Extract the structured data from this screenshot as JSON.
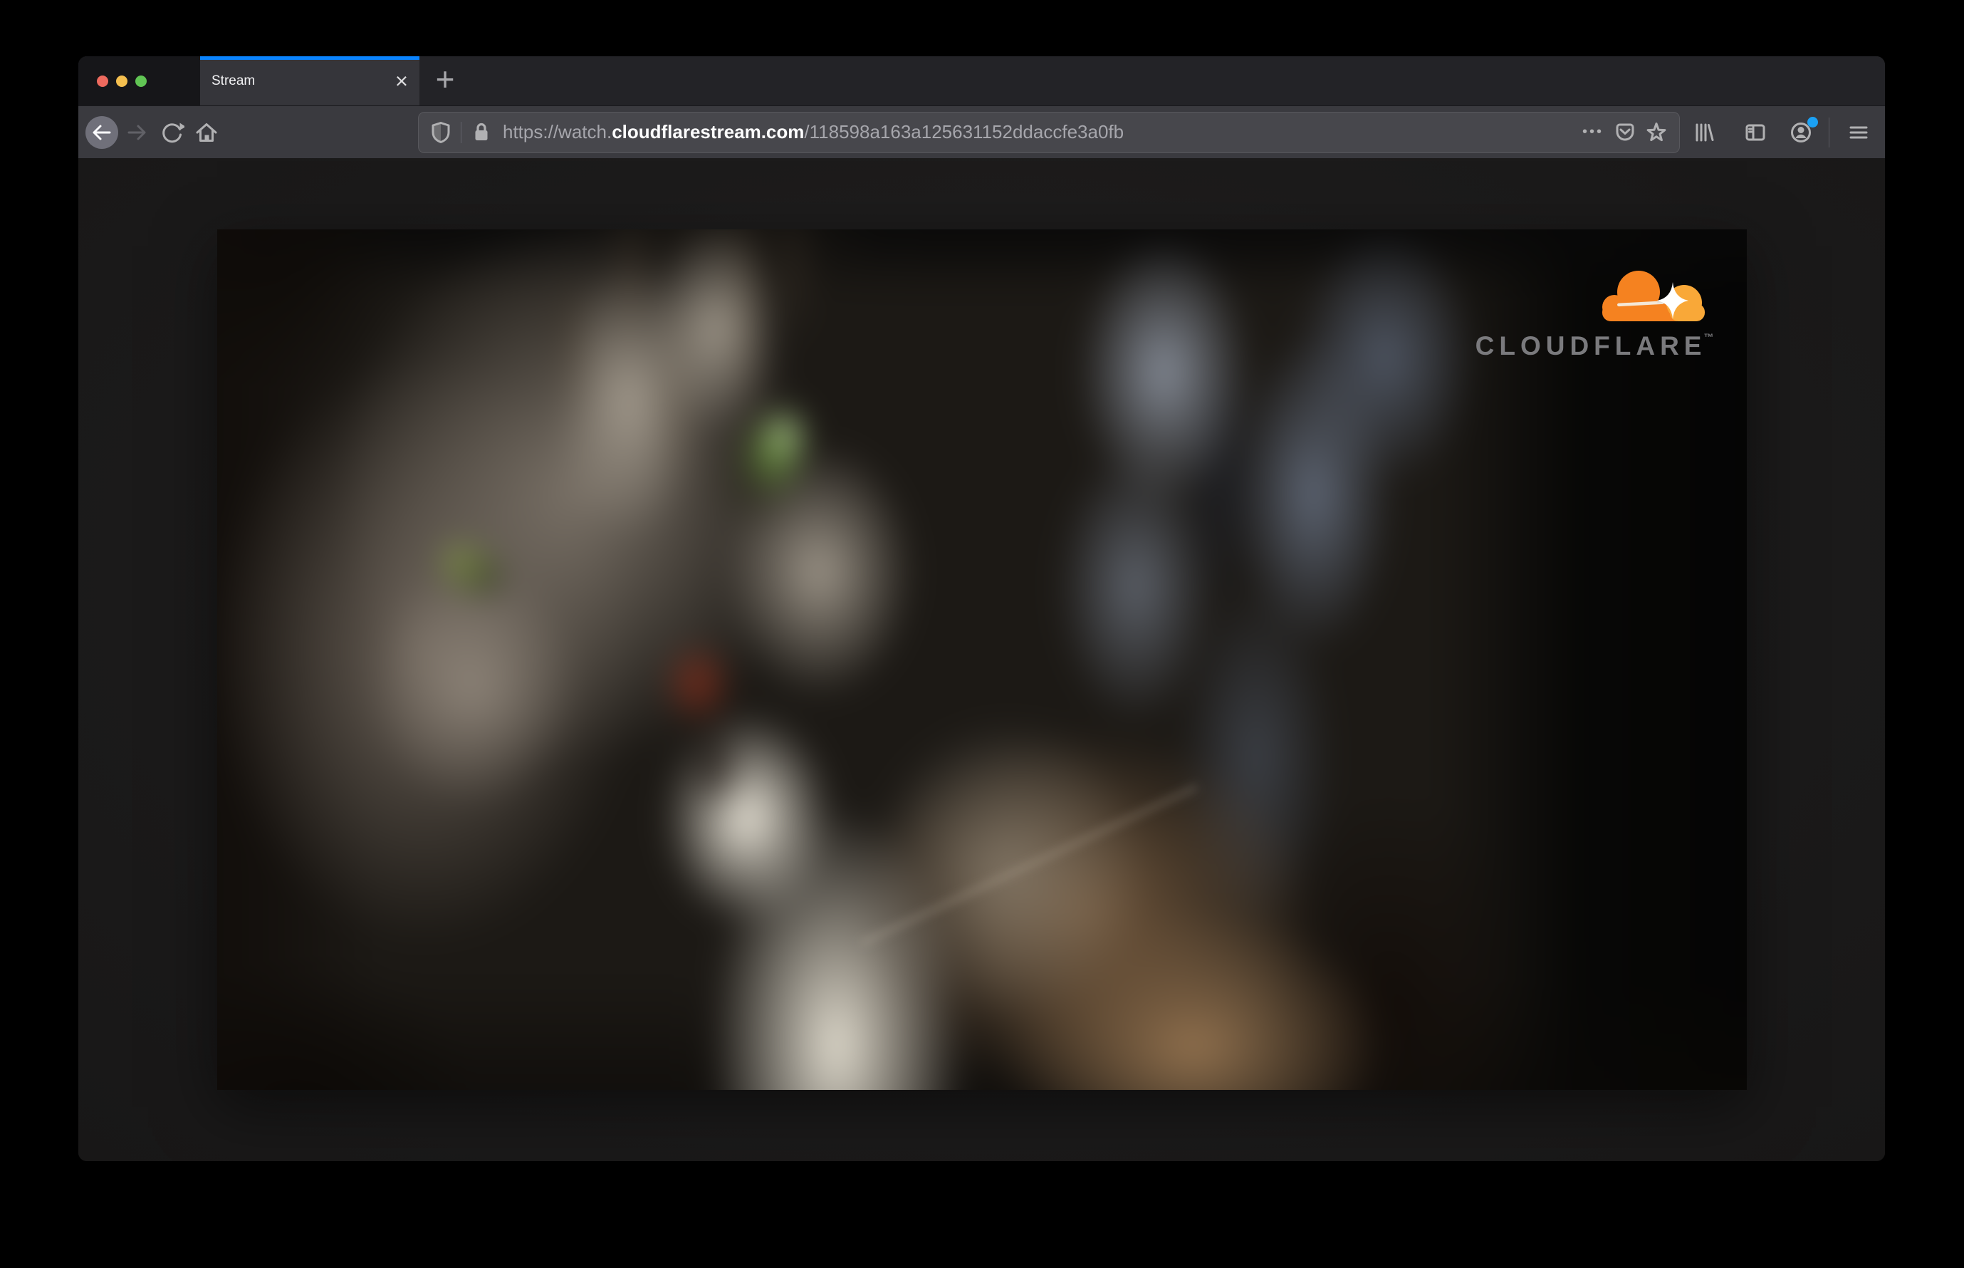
{
  "window": {
    "app": "browser",
    "active_page_title": "Stream"
  },
  "tab_bar": {
    "active_tab": {
      "title": "Stream",
      "close_icon": "×"
    },
    "new_tab_icon": "+"
  },
  "toolbar": {
    "icons": {
      "back": "back-arrow",
      "forward": "forward-arrow",
      "reload": "reload-circular-arrow",
      "home": "house",
      "library": "library-books",
      "sidebar": "sidebar-panels",
      "account": "profile-person-in-circle",
      "menu": "hamburger-menu"
    },
    "account_has_notification": true,
    "url_bar": {
      "shield_icon": "tracking-protection-shield",
      "lock_icon": "padlock",
      "url_prefix": "https://watch.",
      "url_domain": "cloudflarestream.com",
      "url_path": "/118598a163a125631152ddaccfe3a0fb",
      "page_actions_icon": "•••",
      "pocket_icon": "pocket-save-chevron",
      "bookmark_icon": "star-outline"
    }
  },
  "page": {
    "content": "blurry video close-up of a gray tabby cat with green eyes",
    "watermark": {
      "brand": "CLOUDFLARE",
      "trademark": "™"
    }
  },
  "colors": {
    "tab_accent_blue": "#0a84ff",
    "notification_dot_blue": "#1ba1f4",
    "traffic_light_red": "#ee6a5e",
    "traffic_light_yellow": "#f5bf4f",
    "traffic_light_green": "#61c554",
    "cloudflare_orange": "#f58220",
    "cloudflare_orange_light": "#f9a838",
    "toolbar_bg": "#3a3a3f",
    "urlbar_bg": "#47474c",
    "page_bg": "#1d1c1c"
  }
}
